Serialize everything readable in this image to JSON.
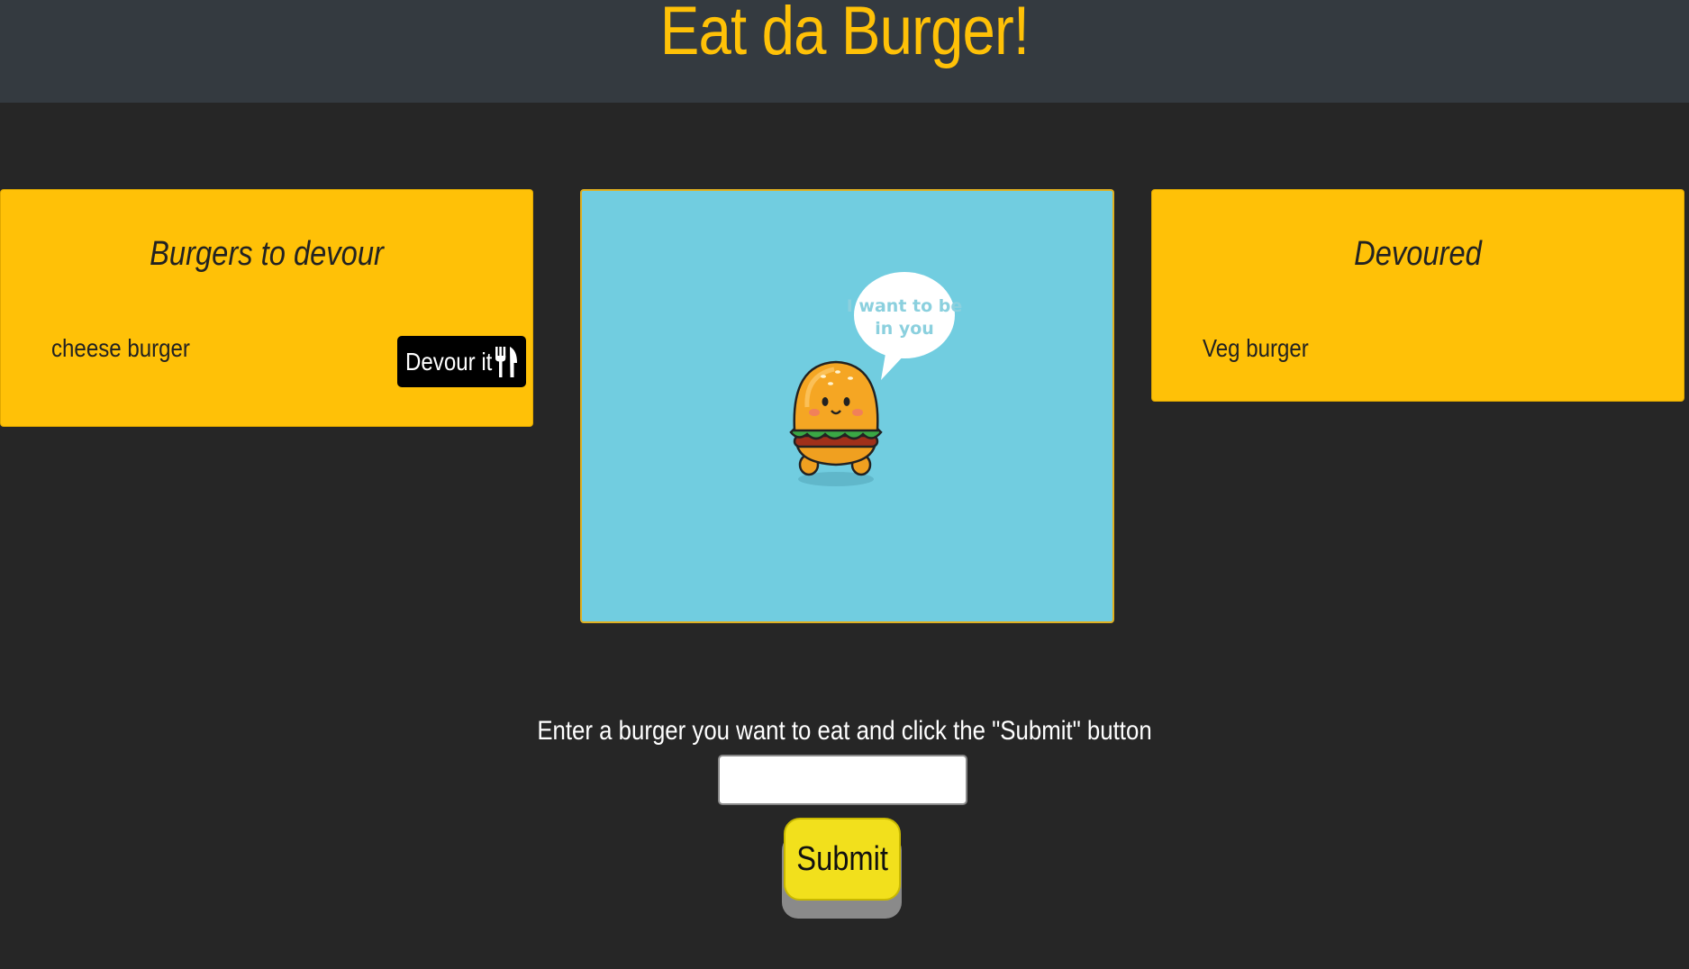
{
  "header": {
    "title": "Eat da Burger!"
  },
  "to_devour": {
    "title": "Burgers to devour",
    "items": [
      {
        "name": "cheese burger",
        "button_label": "Devour it"
      }
    ]
  },
  "devoured": {
    "title": "Devoured",
    "items": [
      {
        "name": "Veg burger"
      }
    ]
  },
  "hero": {
    "speech_line1": "I want to be",
    "speech_line2": "in you"
  },
  "form": {
    "instruction": "Enter a burger you want to eat and click the \"Submit\" button",
    "input_value": "",
    "submit_label": "Submit"
  },
  "colors": {
    "header_bg": "#343a40",
    "page_bg": "#262626",
    "accent": "#ffc107",
    "hero_bg": "#71cde0",
    "submit_bg": "#f2e01c"
  },
  "icons": {
    "devour_icon": "utensils-icon"
  }
}
